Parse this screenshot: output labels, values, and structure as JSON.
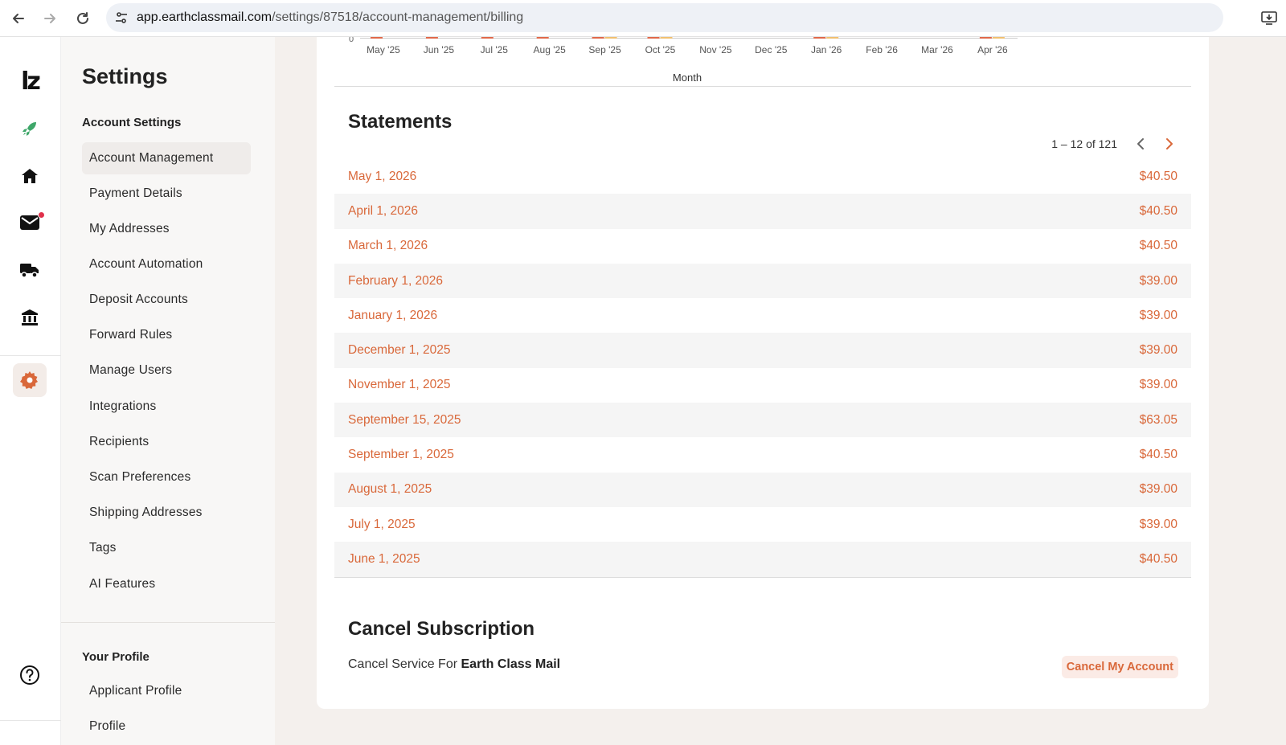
{
  "browser": {
    "url_host": "app.earthclassmail.com",
    "url_path": "/settings/87518/account-management/billing"
  },
  "colors": {
    "accent": "#d9683a",
    "accent_light": "#fbebe6",
    "chart_bar_primary": "#e0694a",
    "chart_bar_secondary": "#f0c070",
    "notification": "#e0314b",
    "rocket": "#3fa76a"
  },
  "rail": {
    "icons": [
      "logo-lz-icon",
      "rocket-icon",
      "home-icon",
      "mail-icon",
      "truck-icon",
      "bank-icon",
      "gear-icon",
      "help-icon"
    ],
    "logo_text": "lz"
  },
  "sidebar": {
    "title": "Settings",
    "account_settings_label": "Account Settings",
    "items": [
      {
        "label": "Account Management",
        "active": true
      },
      {
        "label": "Payment Details"
      },
      {
        "label": "My Addresses"
      },
      {
        "label": "Account Automation"
      },
      {
        "label": "Deposit Accounts"
      },
      {
        "label": "Forward Rules"
      },
      {
        "label": "Manage Users"
      },
      {
        "label": "Integrations"
      },
      {
        "label": "Recipients"
      },
      {
        "label": "Scan Preferences"
      },
      {
        "label": "Shipping Addresses"
      },
      {
        "label": "Tags"
      },
      {
        "label": "AI Features"
      }
    ],
    "profile_label": "Your Profile",
    "profile_items": [
      {
        "label": "Applicant Profile"
      },
      {
        "label": "Profile"
      }
    ]
  },
  "chart_data": {
    "type": "bar",
    "xlabel": "Month",
    "y_tick_visible": "0",
    "categories": [
      "May '25",
      "Jun '25",
      "Jul '25",
      "Aug '25",
      "Sep '25",
      "Oct '25",
      "Nov '25",
      "Dec '25",
      "Jan '26",
      "Feb '26",
      "Mar '26",
      "Apr '26"
    ],
    "series": [
      {
        "color": "#e0694a",
        "has_bar": [
          true,
          true,
          true,
          true,
          true,
          true,
          false,
          false,
          true,
          false,
          false,
          true
        ]
      },
      {
        "color": "#f0c070",
        "has_bar": [
          false,
          false,
          false,
          false,
          true,
          true,
          false,
          false,
          true,
          false,
          false,
          true
        ]
      }
    ]
  },
  "statements": {
    "title": "Statements",
    "pager_text": "1 – 12 of 121",
    "rows": [
      {
        "date": "May 1, 2026",
        "amount": "$40.50"
      },
      {
        "date": "April 1, 2026",
        "amount": "$40.50"
      },
      {
        "date": "March 1, 2026",
        "amount": "$40.50"
      },
      {
        "date": "February 1, 2026",
        "amount": "$39.00"
      },
      {
        "date": "January 1, 2026",
        "amount": "$39.00"
      },
      {
        "date": "December 1, 2025",
        "amount": "$39.00"
      },
      {
        "date": "November 1, 2025",
        "amount": "$39.00"
      },
      {
        "date": "September 15, 2025",
        "amount": "$63.05"
      },
      {
        "date": "September 1, 2025",
        "amount": "$40.50"
      },
      {
        "date": "August 1, 2025",
        "amount": "$39.00"
      },
      {
        "date": "July 1, 2025",
        "amount": "$39.00"
      },
      {
        "date": "June 1, 2025",
        "amount": "$40.50"
      }
    ]
  },
  "cancel": {
    "title": "Cancel Subscription",
    "desc_prefix": "Cancel Service For ",
    "desc_brand": "Earth Class Mail",
    "button_label": "Cancel My Account"
  }
}
